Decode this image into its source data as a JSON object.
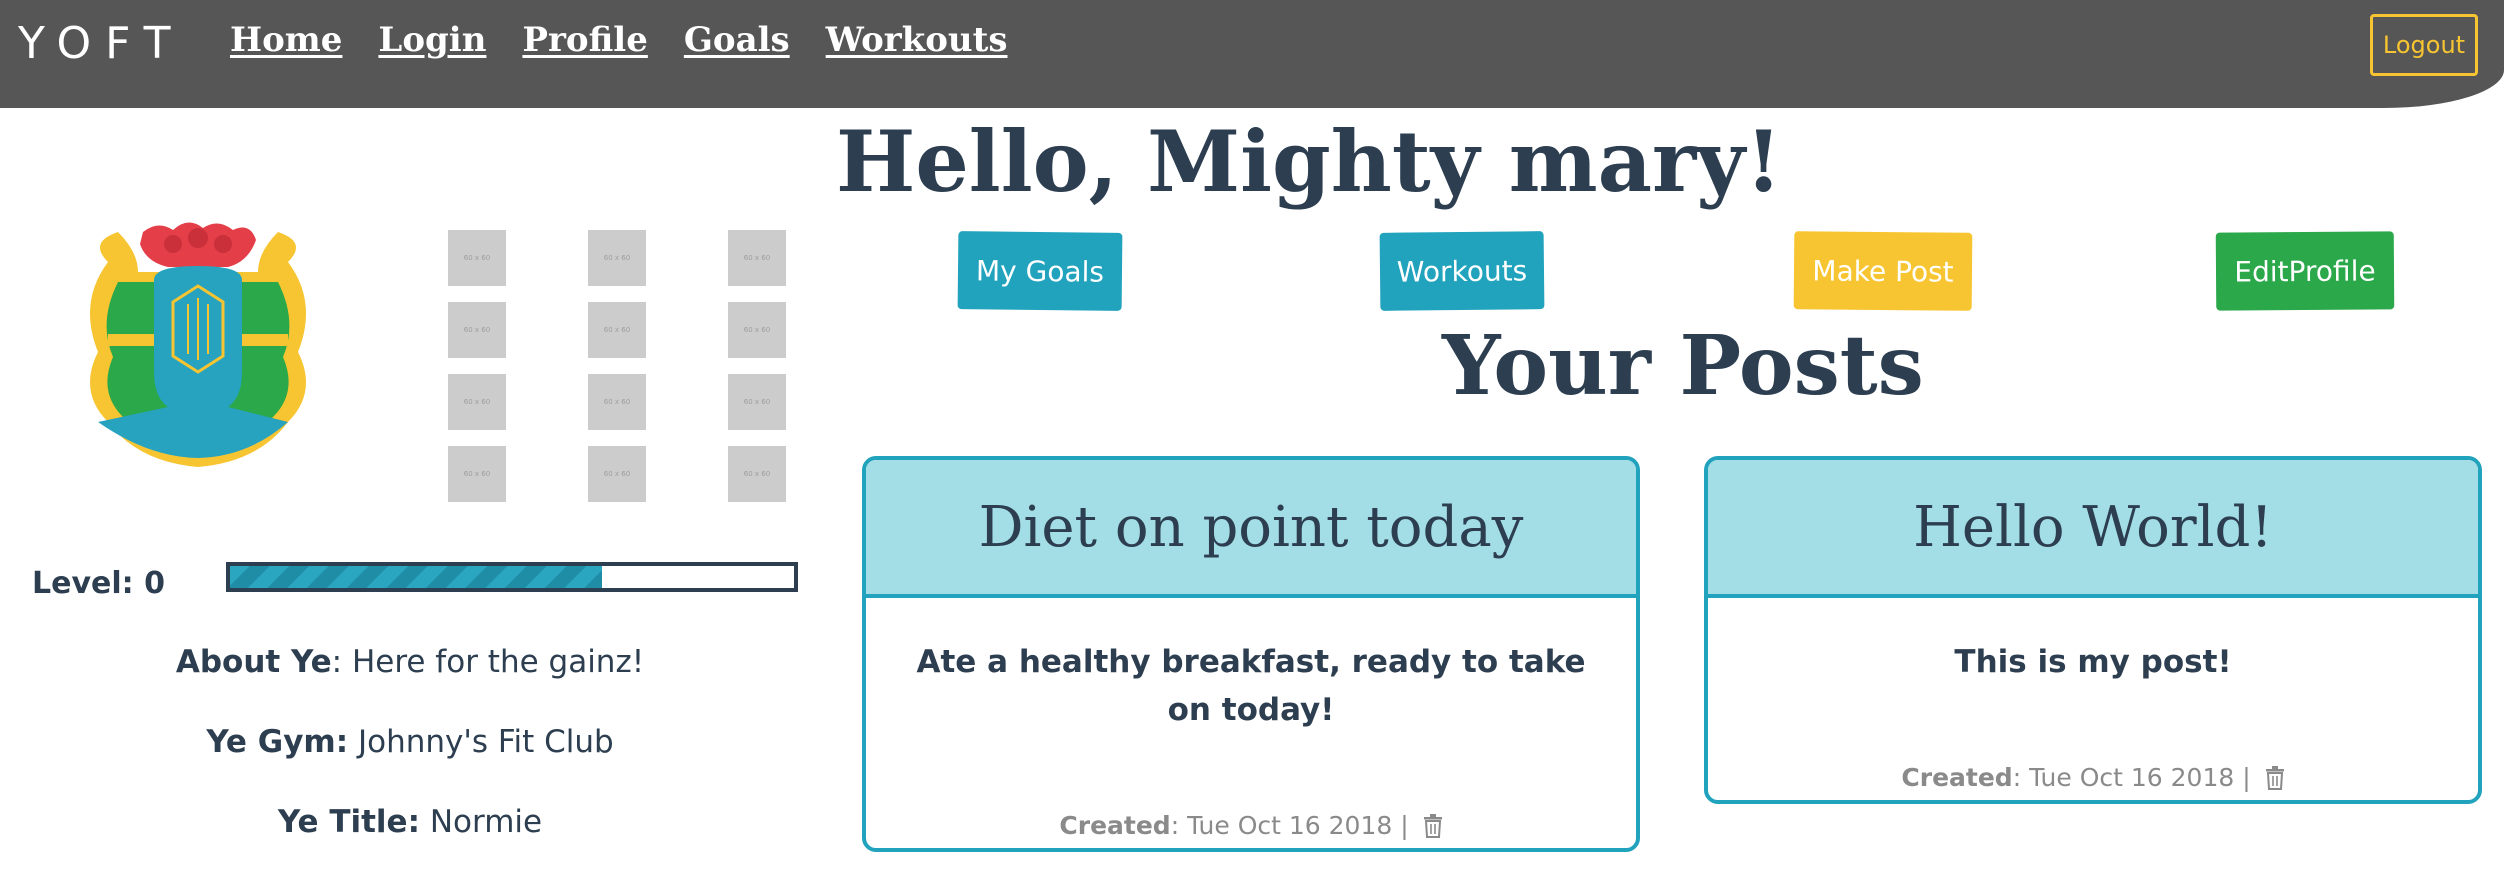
{
  "nav": {
    "brand": "YOFT",
    "links": [
      "Home",
      "Login",
      "Profile",
      "Goals",
      "Workouts"
    ],
    "logout": "Logout"
  },
  "greeting": "Hello, Mighty mary!",
  "profile": {
    "crest_icon": "knight-crest-icon",
    "badge_placeholder": "60 x 60",
    "badge_count": 12,
    "level_label": "Level: 0",
    "level_progress_percent": 66,
    "about_label": "About Ye",
    "about_value": ": Here for the gainz!",
    "gym_label": "Ye Gym:",
    "gym_value": " Johnny's Fit Club",
    "title_label": "Ye Title:",
    "title_value": " Normie"
  },
  "actions": {
    "goals": "My Goals",
    "workouts": "Workouts",
    "make_post": "Make Post",
    "edit_profile": "EditProfile"
  },
  "posts_heading": "Your Posts",
  "posts": [
    {
      "title": "Diet on point today",
      "body": "Ate a healthy breakfast, ready to take on today!",
      "created_label": "Created",
      "created_value": ": Tue Oct 16 2018 |"
    },
    {
      "title": "Hello World!",
      "body": "This is my post!",
      "created_label": "Created",
      "created_value": ": Tue Oct 16 2018 |"
    }
  ],
  "colors": {
    "navbar": "#565656",
    "accent_blue": "#21a3bd",
    "accent_yellow": "#f7c531",
    "accent_green": "#2aa84a",
    "card_header": "#a3dee7",
    "text": "#2c3e50"
  }
}
